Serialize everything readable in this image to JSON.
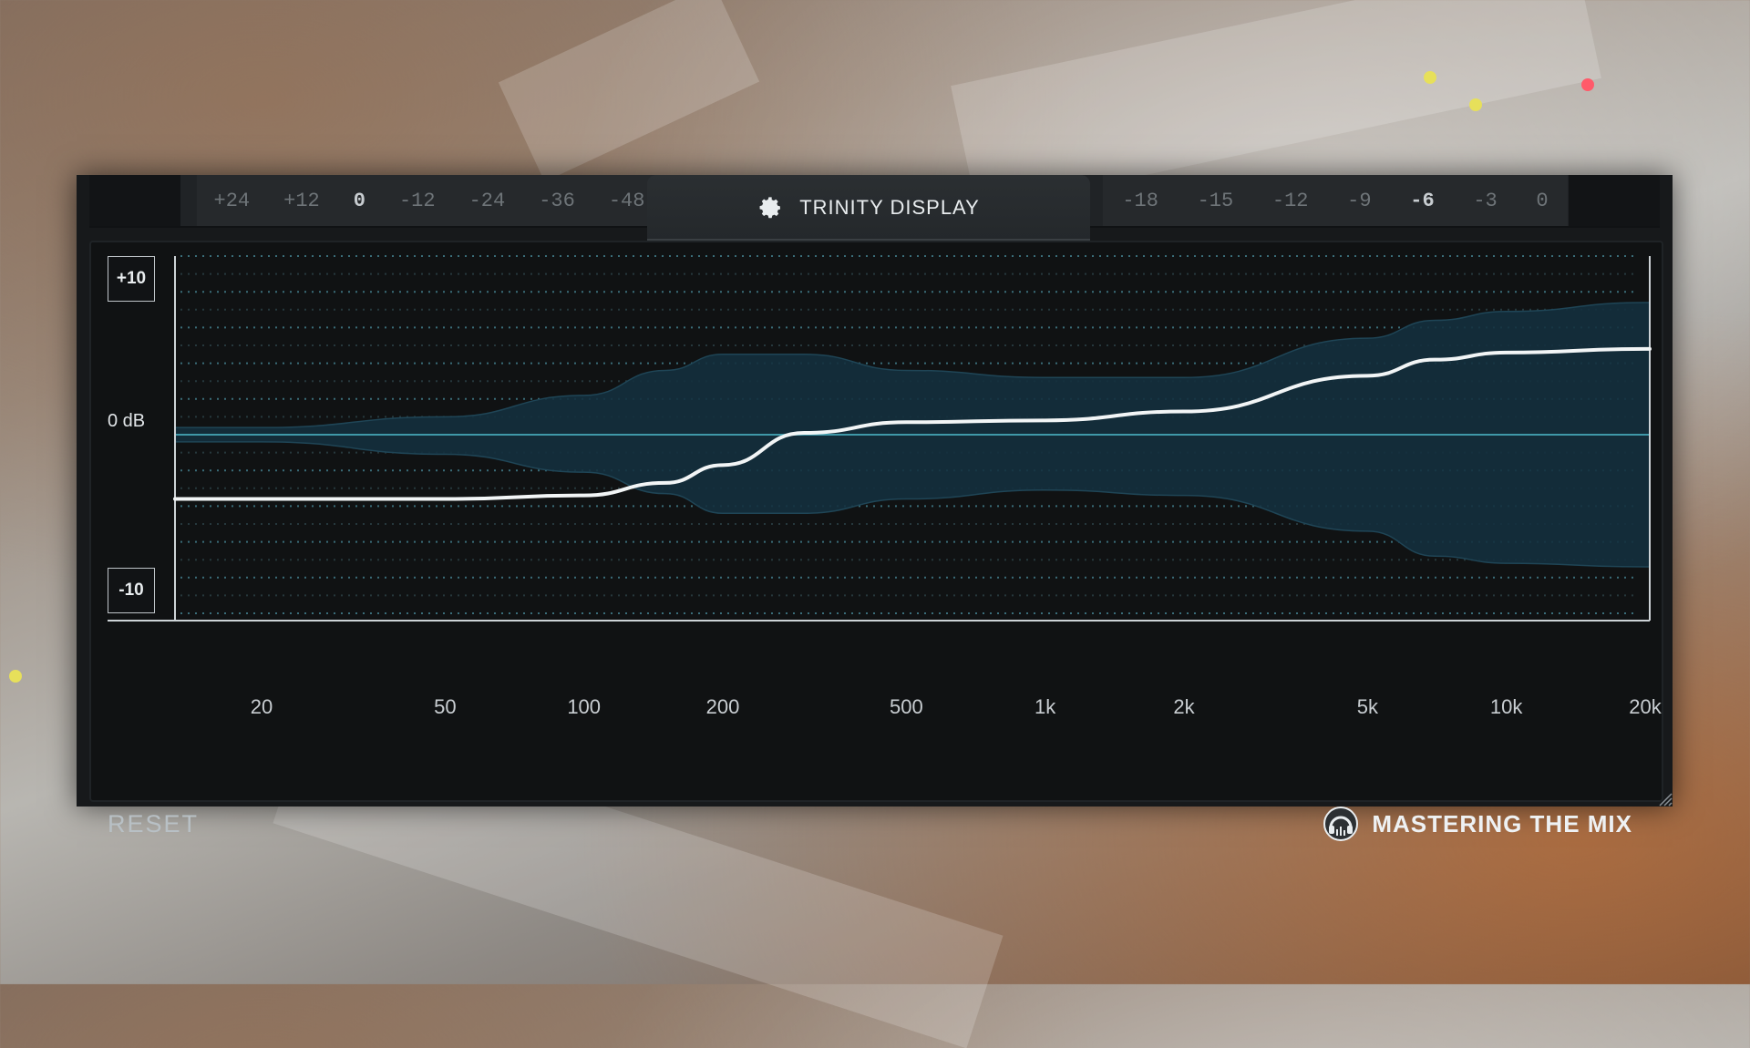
{
  "header": {
    "title": "TRINITY DISPLAY",
    "left_meter_ticks": [
      "+24",
      "+12",
      "0",
      "-12",
      "-24",
      "-36",
      "-48"
    ],
    "left_meter_highlight": "0",
    "right_meter_ticks": [
      "-18",
      "-15",
      "-12",
      "-9",
      "-6",
      "-3",
      "0"
    ],
    "right_meter_highlight": "-6"
  },
  "graph": {
    "db_top": "+10",
    "db_zero": "0 dB",
    "db_bottom": "-10",
    "freq_ticks": [
      {
        "label": "20",
        "hz": 20
      },
      {
        "label": "50",
        "hz": 50
      },
      {
        "label": "100",
        "hz": 100
      },
      {
        "label": "200",
        "hz": 200
      },
      {
        "label": "500",
        "hz": 500
      },
      {
        "label": "1k",
        "hz": 1000
      },
      {
        "label": "2k",
        "hz": 2000
      },
      {
        "label": "5k",
        "hz": 5000
      },
      {
        "label": "10k",
        "hz": 10000
      },
      {
        "label": "20k",
        "hz": 20000
      }
    ]
  },
  "chart_data": {
    "type": "line",
    "xlabel": "",
    "ylabel": "",
    "x_scale": "log",
    "xlim": [
      20,
      20000
    ],
    "ylim": [
      -10,
      10
    ],
    "series": [
      {
        "x": [
          12,
          20,
          50,
          100,
          150,
          200,
          300,
          500,
          1000,
          2000,
          5000,
          7000,
          10000,
          20000,
          24000
        ],
        "values": [
          -3.6,
          -3.6,
          -3.6,
          -3.4,
          -2.7,
          -1.7,
          0.1,
          0.7,
          0.8,
          1.3,
          3.3,
          4.2,
          4.6,
          4.8,
          4.8
        ]
      }
    ],
    "band": {
      "x": [
        12,
        20,
        50,
        100,
        150,
        200,
        300,
        500,
        1000,
        2000,
        5000,
        7000,
        10000,
        20000,
        24000
      ],
      "upper": [
        0.4,
        0.4,
        1.0,
        2.2,
        3.6,
        4.5,
        4.5,
        3.6,
        3.2,
        3.2,
        5.4,
        6.4,
        6.9,
        7.4,
        7.4
      ],
      "lower": [
        -0.4,
        -0.4,
        -1.1,
        -2.1,
        -3.3,
        -4.4,
        -4.4,
        -3.6,
        -3.1,
        -3.4,
        -5.4,
        -6.8,
        -7.2,
        -7.4,
        -7.4
      ]
    }
  },
  "footer": {
    "reset_label": "RESET",
    "brand_name": "MASTERING THE MIX"
  },
  "colors": {
    "band_fill": "#14303e",
    "band_stroke": "#1f4556",
    "curve": "#f2f5f6",
    "zero_line": "#3f98a8",
    "grid_dots": "#3a6d79"
  }
}
